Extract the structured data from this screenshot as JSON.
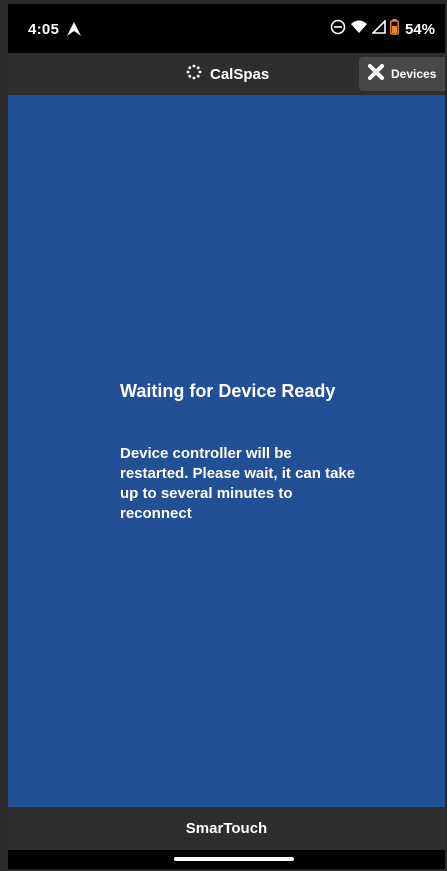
{
  "status_bar": {
    "time": "4:05",
    "battery": "54%",
    "icons": [
      "navigation-icon",
      "do-not-disturb-icon",
      "wifi-icon",
      "signal-icon",
      "battery-icon"
    ]
  },
  "header": {
    "title": "CalSpas",
    "logo_icon": "loading-dots-icon",
    "devices_button": {
      "label": "Devices",
      "icon": "close-x-icon"
    }
  },
  "main": {
    "title": "Waiting for Device Ready",
    "message": "Device controller will be restarted. Please wait, it can take up to several minutes to reconnect"
  },
  "footer": {
    "label": "SmarTouch"
  },
  "colors": {
    "main_background": "#234f96",
    "bar_background": "#2e2e2e",
    "button_background": "#484848",
    "battery_accent": "#f08a24"
  }
}
